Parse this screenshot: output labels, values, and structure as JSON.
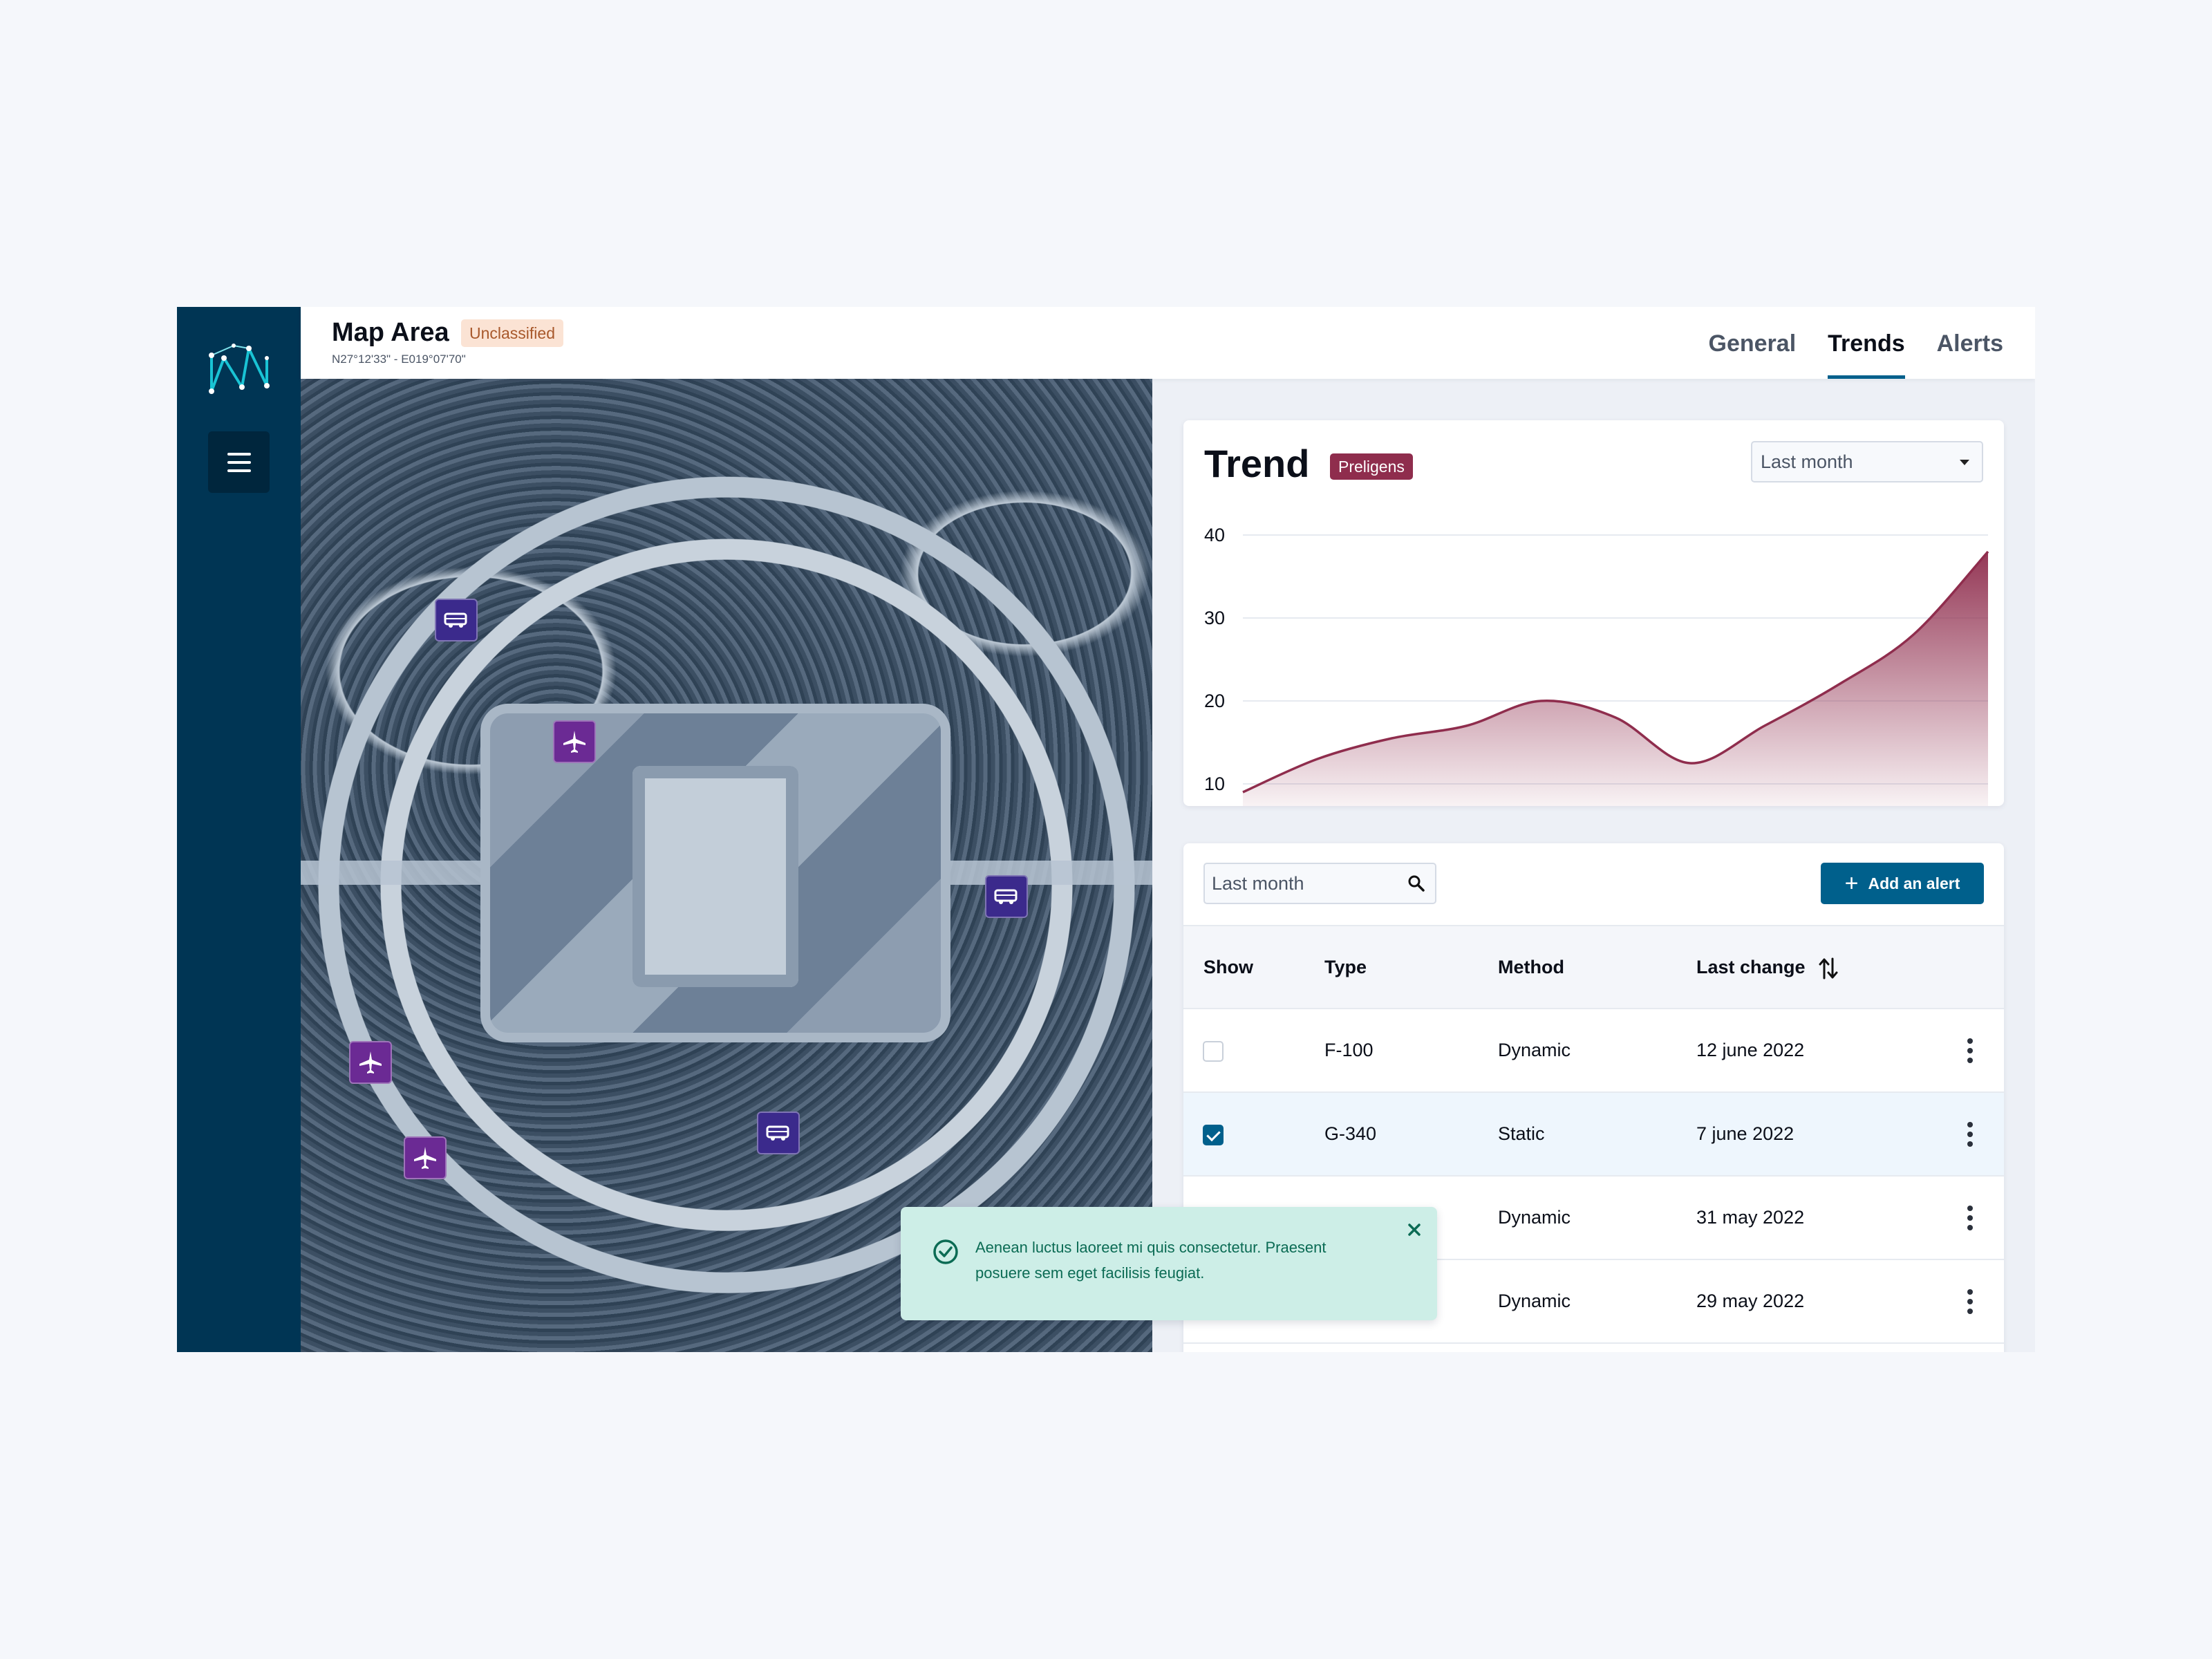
{
  "header": {
    "title": "Map Area",
    "classification": "Unclassified",
    "coordinates": "N27°12'33\" - E019°07'70\""
  },
  "tabs": [
    {
      "label": "General",
      "active": false
    },
    {
      "label": "Trends",
      "active": true
    },
    {
      "label": "Alerts",
      "active": false
    }
  ],
  "map": {
    "markers": [
      {
        "kind": "van",
        "icon": "van-icon"
      },
      {
        "kind": "plane",
        "icon": "airplane-icon"
      },
      {
        "kind": "van",
        "icon": "van-icon"
      },
      {
        "kind": "plane",
        "icon": "airplane-icon"
      },
      {
        "kind": "plane",
        "icon": "airplane-icon"
      },
      {
        "kind": "van",
        "icon": "van-icon"
      }
    ]
  },
  "trend": {
    "title": "Trend",
    "badge": "Preligens",
    "period": "Last month"
  },
  "chart_data": {
    "type": "area",
    "x": [
      0,
      1,
      2,
      3,
      4,
      5,
      6,
      7,
      8,
      9,
      10
    ],
    "values": [
      9,
      13,
      15.5,
      17,
      20,
      18,
      12.5,
      17,
      22,
      28,
      38
    ],
    "yticks": [
      10,
      20,
      30,
      40
    ],
    "ylim": [
      8,
      41
    ],
    "grid": true,
    "color": "#8f2d4d"
  },
  "table": {
    "search_placeholder": "Last month",
    "add_button": "Add an alert",
    "columns": [
      "Show",
      "Type",
      "Method",
      "Last change"
    ],
    "rows": [
      {
        "show": false,
        "type": "F-100",
        "method": "Dynamic",
        "last_change": "12 june 2022"
      },
      {
        "show": true,
        "type": "G-340",
        "method": "Static",
        "last_change": "7 june 2022"
      },
      {
        "show": false,
        "type": "",
        "method": "Dynamic",
        "last_change": "31 may 2022"
      },
      {
        "show": false,
        "type": "",
        "method": "Dynamic",
        "last_change": "29 may 2022"
      }
    ]
  },
  "toast": {
    "message": "Aenean luctus laoreet mi quis consectetur. Praesent posuere sem eget facilisis feugiat."
  },
  "colors": {
    "sidebar": "#003554",
    "accent": "#00608c",
    "trend": "#8f2d4d",
    "toast_bg": "#cdeee7"
  }
}
